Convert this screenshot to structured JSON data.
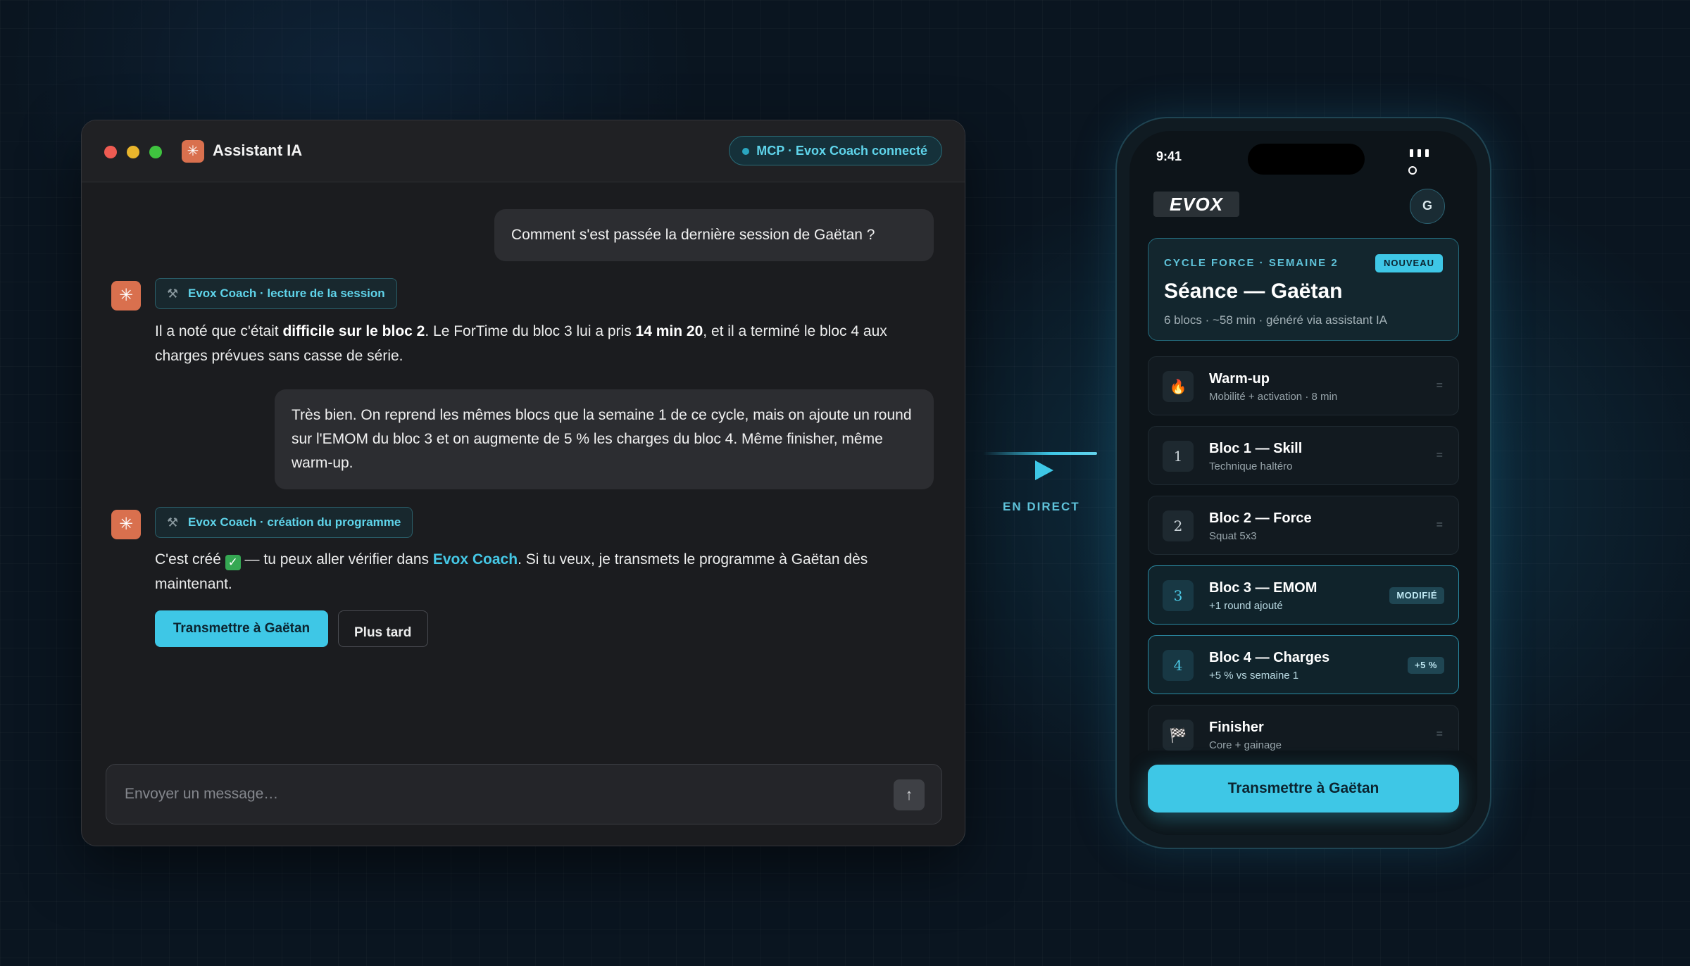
{
  "chat": {
    "app_title": "Assistant IA",
    "app_icon": "asterisk-icon",
    "mcp_status": "MCP · Evox Coach connecté",
    "messages": {
      "user1": "Comment s'est passée la dernière session de Gaëtan ?",
      "tool1": "Evox Coach · lecture de la session",
      "ai1_a": "Il a noté que c'était ",
      "ai1_b": "difficile sur le bloc 2",
      "ai1_c": ". Le ForTime du bloc 3 lui a pris ",
      "ai1_d": "14 min 20",
      "ai1_e": ", et il a terminé le bloc 4 aux charges prévues sans casse de série.",
      "user2": "Très bien. On reprend les mêmes blocs que la semaine 1 de ce cycle, mais on ajoute un round sur l'EMOM du bloc 3 et on augmente de 5 % les charges du bloc 4. Même finisher, même warm-up.",
      "tool2": "Evox Coach · création du programme",
      "ai2_a": "C'est créé ",
      "ai2_check": "✓",
      "ai2_b": " — tu peux aller vérifier dans ",
      "ai2_link": "Evox Coach",
      "ai2_c": ". Si tu veux, je transmets le programme à Gaëtan dès maintenant."
    },
    "btn_send_to": "Transmettre à Gaëtan",
    "btn_later": "Plus tard",
    "composer_placeholder": "Envoyer un message…"
  },
  "flow": {
    "live_label": "EN DIRECT"
  },
  "phone": {
    "time": "9:41",
    "logo": "EVOX",
    "avatar_initial": "G",
    "hero": {
      "cycle": "CYCLE FORCE · SEMAINE 2",
      "badge": "NOUVEAU",
      "title": "Séance — Gaëtan",
      "subtitle": "6 blocs · ~58 min · généré via assistant IA"
    },
    "blocks": [
      {
        "icon": "🔥",
        "title": "Warm-up",
        "subtitle": "Mobilité + activation · 8 min",
        "badge": ""
      },
      {
        "icon": "1",
        "title": "Bloc 1 — Skill",
        "subtitle": "Technique haltéro",
        "badge": ""
      },
      {
        "icon": "2",
        "title": "Bloc 2 — Force",
        "subtitle": "Squat 5x3",
        "badge": ""
      },
      {
        "icon": "3",
        "title": "Bloc 3 — EMOM",
        "subtitle": "+1 round ajouté",
        "badge": "MODIFIÉ"
      },
      {
        "icon": "4",
        "title": "Bloc 4 — Charges",
        "subtitle": "+5 % vs semaine 1",
        "badge": "+5 %"
      },
      {
        "icon": "🏁",
        "title": "Finisher",
        "subtitle": "Core + gainage",
        "badge": ""
      }
    ],
    "cta": "Transmettre à Gaëtan"
  },
  "colors": {
    "accent": "#3ec7e6",
    "ai_avatar": "#d9704e",
    "background": "#0a1520"
  }
}
